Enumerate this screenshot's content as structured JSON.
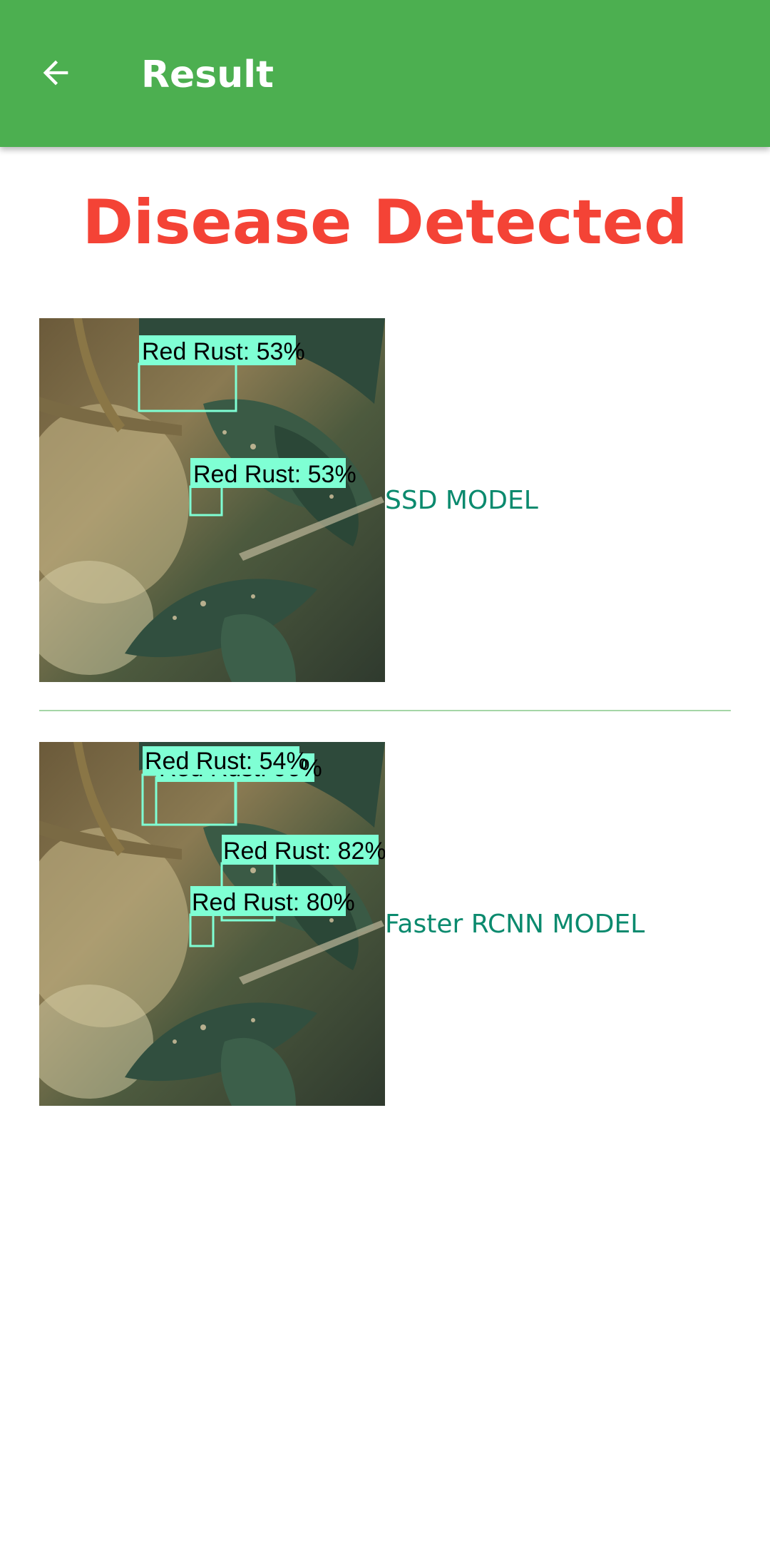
{
  "appbar": {
    "title": "Result",
    "back_icon": "arrow-left-icon",
    "background": "#4caf50"
  },
  "headline": {
    "text": "Disease Detected",
    "color": "#f44336"
  },
  "results": [
    {
      "model": "SSD MODEL",
      "detections": [
        "Red Rust: 53%",
        "Red Rust: 53%"
      ]
    },
    {
      "model": "Faster RCNN MODEL",
      "detections": [
        "Red Rust: 54%",
        "Red Rust: 96%",
        "Red Rust: 82%",
        "Red Rust: 80%"
      ]
    }
  ],
  "colors": {
    "label_text": "#0b8a6e",
    "box": "#7fffd4",
    "divider": "#a5d6a7"
  }
}
